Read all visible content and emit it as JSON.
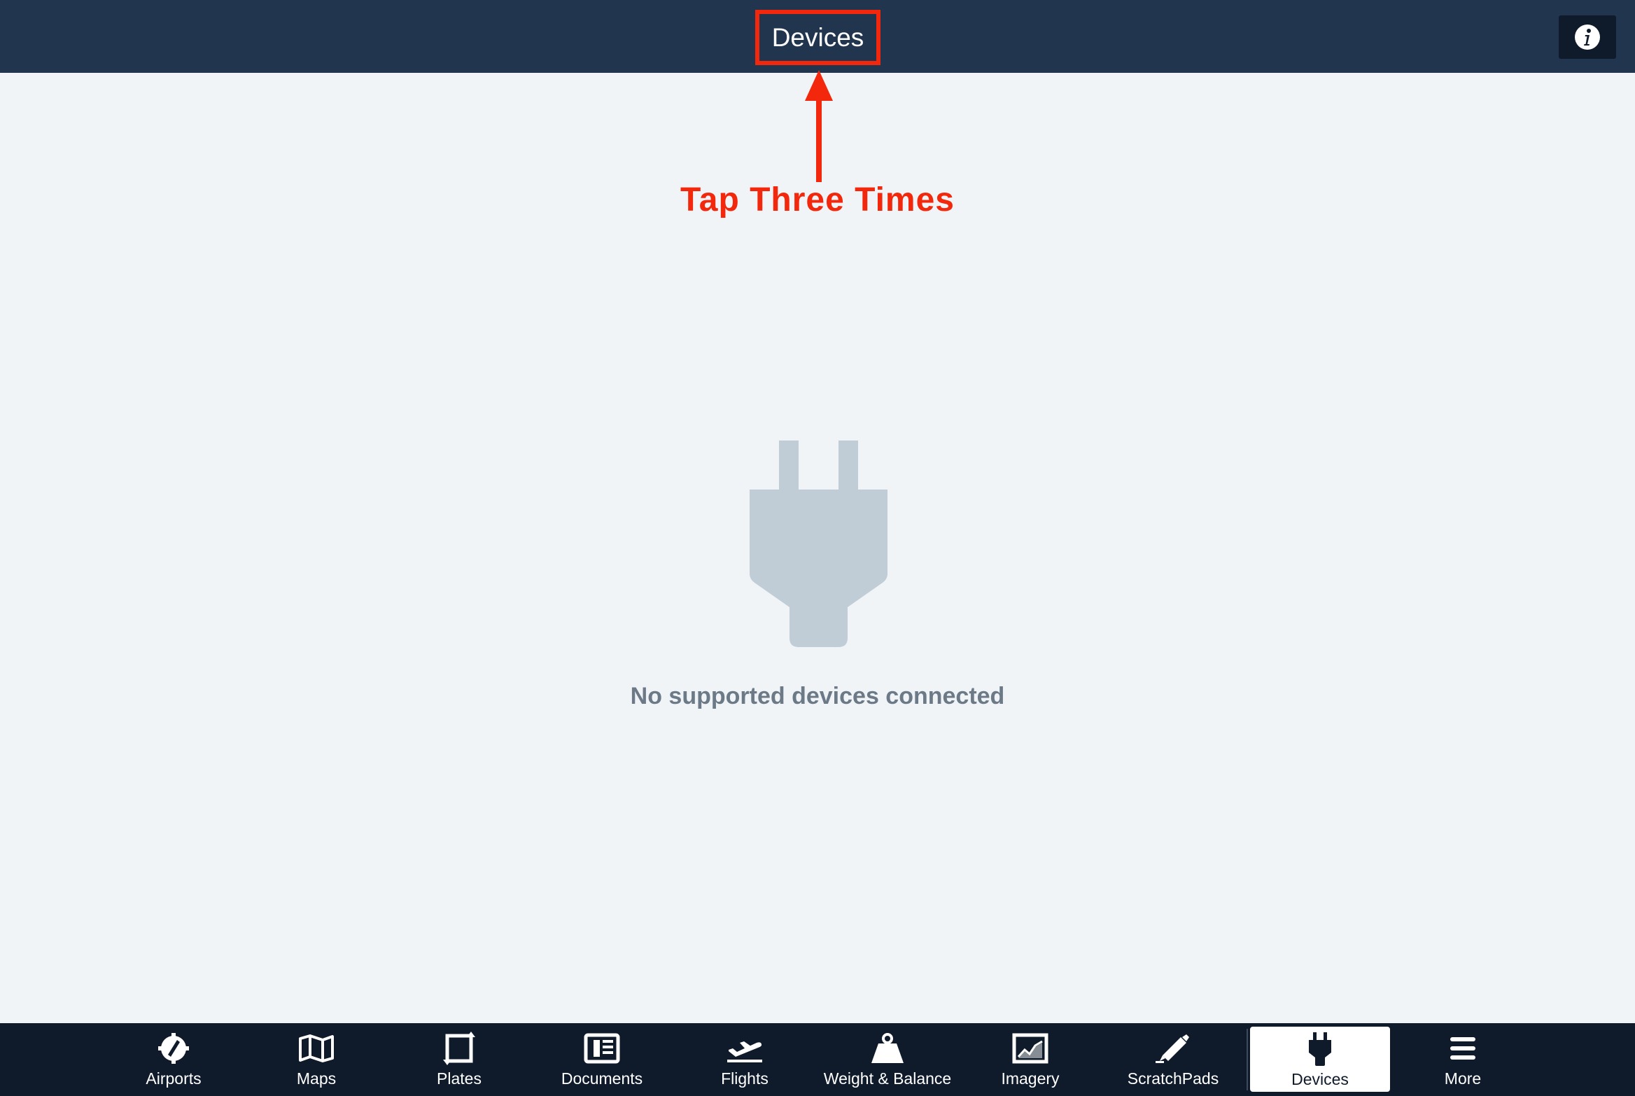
{
  "header": {
    "title": "Devices"
  },
  "annotation": {
    "text": "Tap Three Times"
  },
  "main": {
    "empty_message": "No supported devices connected"
  },
  "tabs": [
    {
      "label": "Airports",
      "icon": "compass-icon"
    },
    {
      "label": "Maps",
      "icon": "map-icon"
    },
    {
      "label": "Plates",
      "icon": "plates-icon"
    },
    {
      "label": "Documents",
      "icon": "documents-icon"
    },
    {
      "label": "Flights",
      "icon": "airplane-takeoff-icon"
    },
    {
      "label": "Weight & Balance",
      "icon": "weight-icon"
    },
    {
      "label": "Imagery",
      "icon": "imagery-chart-icon"
    },
    {
      "label": "ScratchPads",
      "icon": "pencil-icon"
    },
    {
      "label": "Devices",
      "icon": "plug-icon",
      "active": true
    },
    {
      "label": "More",
      "icon": "menu-icon"
    }
  ],
  "colors": {
    "header_bg": "#21354e",
    "tabbar_bg": "#0f1b2b",
    "annotation": "#f2270c",
    "placeholder_icon": "#c0ccd6",
    "background": "#f1f4f7"
  }
}
